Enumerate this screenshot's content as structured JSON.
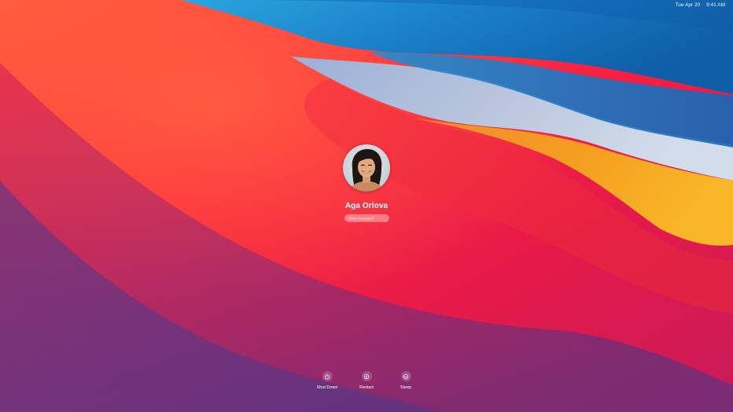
{
  "status_bar": {
    "date": "Tue Apr 20",
    "time": "9:41 AM"
  },
  "user": {
    "name": "Aga Orlova",
    "avatar": "user-photo"
  },
  "password": {
    "placeholder": "Enter Password",
    "value": ""
  },
  "power_actions": [
    {
      "label": "Shut Down",
      "icon": "power-icon"
    },
    {
      "label": "Restart",
      "icon": "restart-icon"
    },
    {
      "label": "Sleep",
      "icon": "sleep-icon"
    }
  ],
  "colors": {
    "wallpaper_red": "#e8203a",
    "wallpaper_blue": "#1a78c2",
    "wallpaper_orange": "#f4a020",
    "wallpaper_purple": "#5a3a8a"
  }
}
